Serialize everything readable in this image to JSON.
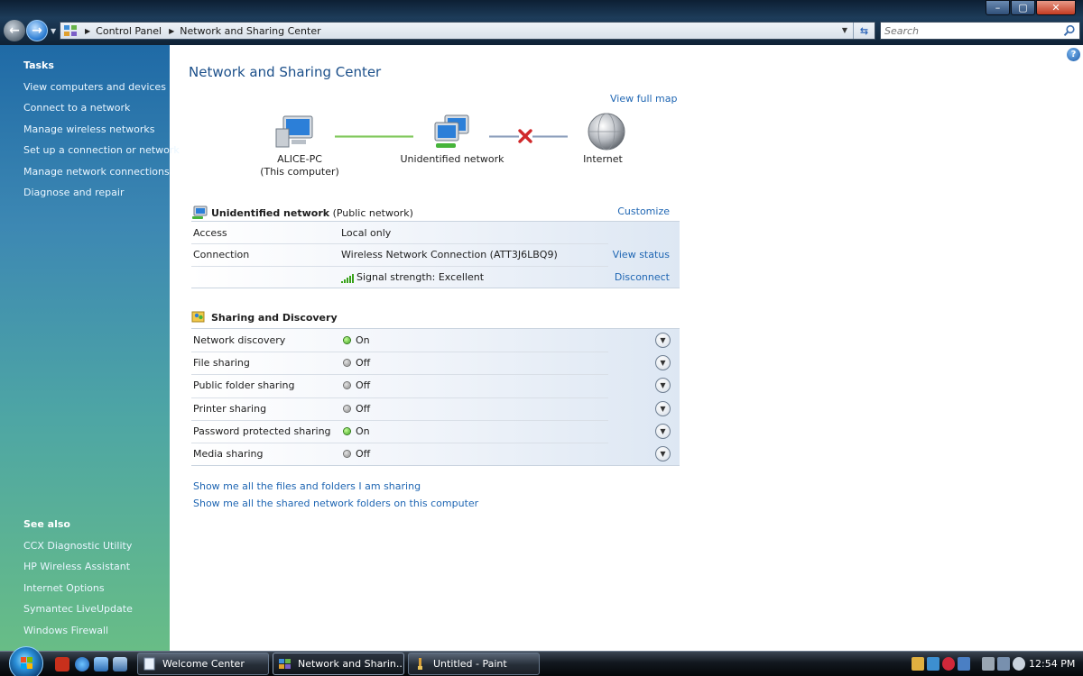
{
  "window": {
    "minimize": "–",
    "maximize": "▢",
    "close": "✕"
  },
  "address_bar": {
    "breadcrumbs": [
      "Control Panel",
      "Network and Sharing Center"
    ],
    "search_placeholder": "Search"
  },
  "sidebar": {
    "tasks_title": "Tasks",
    "tasks": [
      "View computers and devices",
      "Connect to a network",
      "Manage wireless networks",
      "Set up a connection or network",
      "Manage network connections",
      "Diagnose and repair"
    ],
    "see_also_title": "See also",
    "see_also": [
      "CCX Diagnostic Utility",
      "HP Wireless Assistant",
      "Internet Options",
      "Symantec LiveUpdate",
      "Windows Firewall"
    ]
  },
  "main": {
    "title": "Network and Sharing Center",
    "view_full_map": "View full map",
    "map": {
      "computer_name": "ALICE-PC",
      "computer_sub": "(This computer)",
      "network": "Unidentified network",
      "internet": "Internet"
    },
    "network_section": {
      "name": "Unidentified network",
      "type": "(Public network)",
      "customize": "Customize",
      "rows": [
        {
          "label": "Access",
          "value": "Local only",
          "action": ""
        },
        {
          "label": "Connection",
          "value": "Wireless Network Connection (ATT3J6LBQ9)",
          "action": "View status"
        },
        {
          "label": "",
          "value": "Signal strength:  Excellent",
          "action": "Disconnect"
        }
      ]
    },
    "sharing_section": {
      "title": "Sharing and Discovery",
      "rows": [
        {
          "label": "Network discovery",
          "status": "On"
        },
        {
          "label": "File sharing",
          "status": "Off"
        },
        {
          "label": "Public folder sharing",
          "status": "Off"
        },
        {
          "label": "Printer sharing",
          "status": "Off"
        },
        {
          "label": "Password protected sharing",
          "status": "On"
        },
        {
          "label": "Media sharing",
          "status": "Off"
        }
      ]
    },
    "links": [
      "Show me all the files and folders I am sharing",
      "Show me all the shared network folders on this computer"
    ]
  },
  "taskbar": {
    "buttons": [
      {
        "label": "Welcome Center",
        "active": false
      },
      {
        "label": "Network and Sharin...",
        "active": true
      },
      {
        "label": "Untitled - Paint",
        "active": false
      }
    ],
    "clock": "12:54 PM"
  },
  "colors": {
    "link": "#1f66b3",
    "title": "#1b4f8a",
    "status_on": "#3aa21b",
    "status_off": "#8a8a8a"
  }
}
